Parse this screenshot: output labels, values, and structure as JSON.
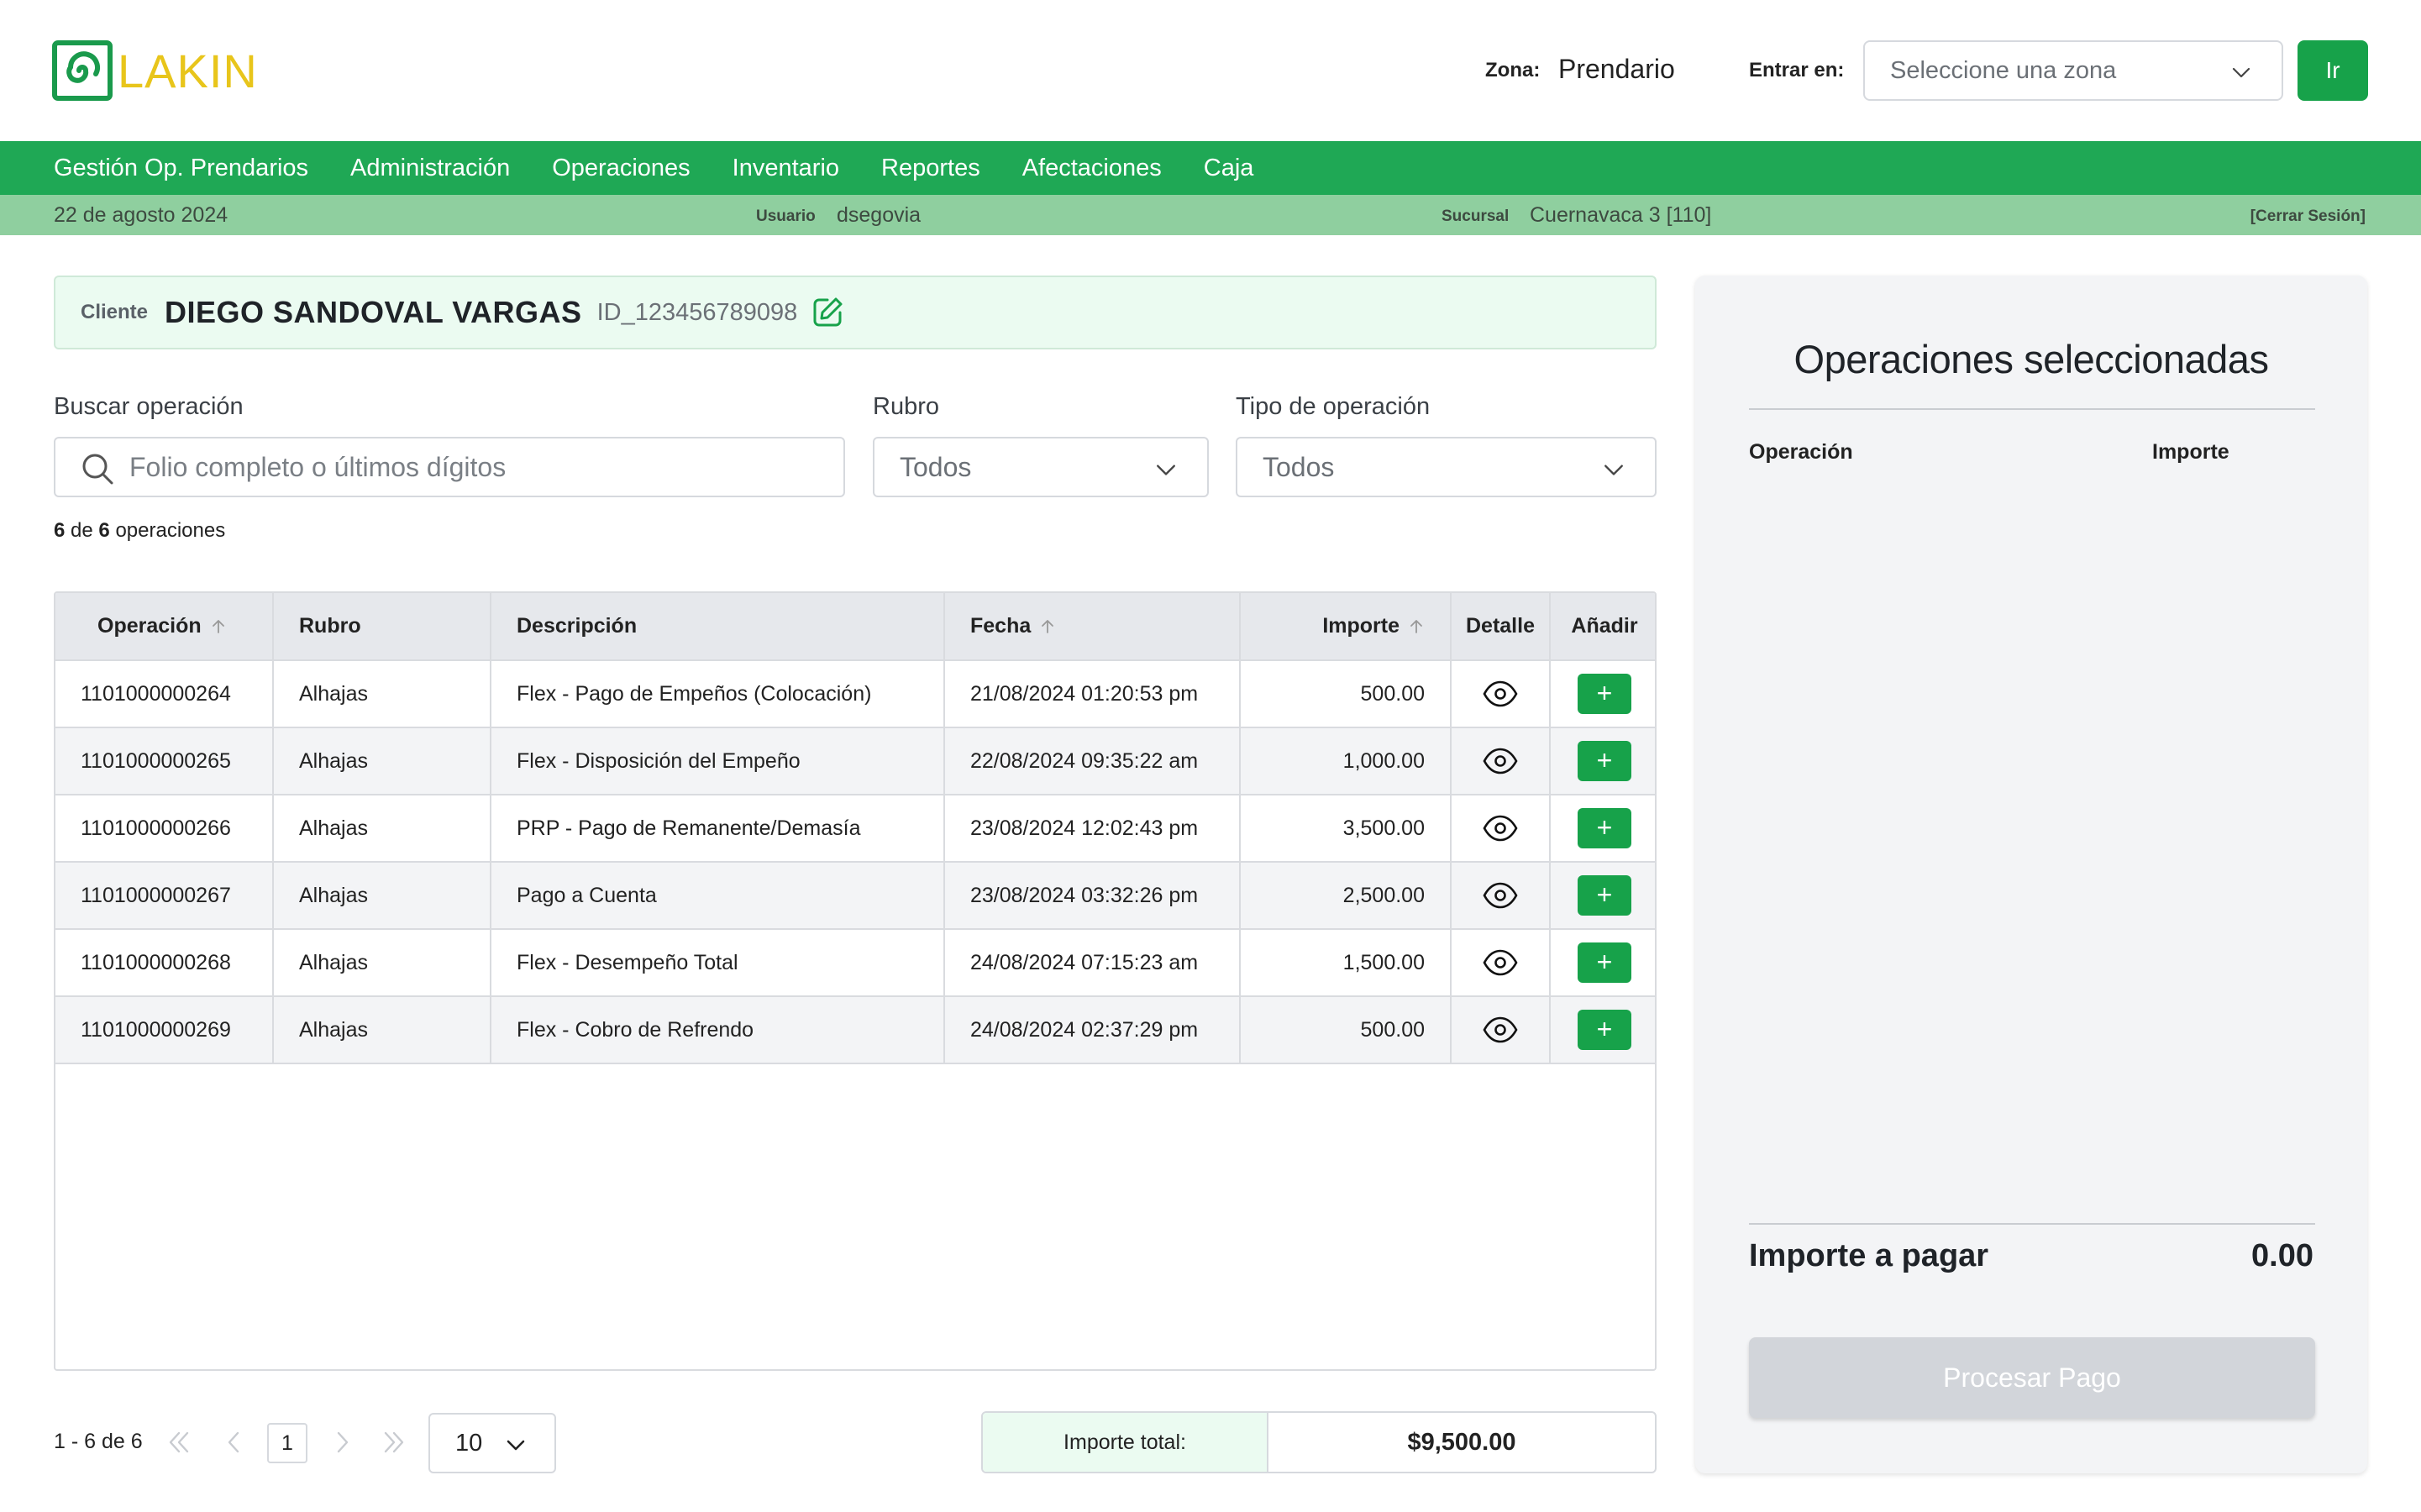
{
  "header": {
    "logo_text": "LAKIN",
    "zona_label": "Zona:",
    "zona_value": "Prendario",
    "entrar_label": "Entrar en:",
    "zona_select_placeholder": "Seleccione una zona",
    "go_label": "Ir"
  },
  "nav": {
    "items": [
      {
        "label": "Gestión Op. Prendarios"
      },
      {
        "label": "Administración"
      },
      {
        "label": "Operaciones"
      },
      {
        "label": "Inventario"
      },
      {
        "label": "Reportes"
      },
      {
        "label": "Afectaciones"
      },
      {
        "label": "Caja"
      }
    ]
  },
  "infobar": {
    "date": "22 de agosto 2024",
    "user_label": "Usuario",
    "user_value": "dsegovia",
    "branch_label": "Sucursal",
    "branch_value": "Cuernavaca 3 [110]",
    "logout": "[Cerrar Sesión]"
  },
  "client": {
    "label": "Cliente",
    "name": "DIEGO SANDOVAL VARGAS",
    "id": "ID_123456789098"
  },
  "filters": {
    "search_label": "Buscar operación",
    "search_placeholder": "Folio completo o últimos dígitos",
    "rubro_label": "Rubro",
    "rubro_value": "Todos",
    "tipo_label": "Tipo de operación",
    "tipo_value": "Todos"
  },
  "count": {
    "shown": "6",
    "of": "de",
    "total": "6",
    "suffix": "operaciones"
  },
  "table": {
    "headers": {
      "operacion": "Operación",
      "rubro": "Rubro",
      "descripcion": "Descripción",
      "fecha": "Fecha",
      "importe": "Importe",
      "detalle": "Detalle",
      "anadir": "Añadir"
    },
    "add_symbol": "+",
    "rows": [
      {
        "operacion": "1101000000264",
        "rubro": "Alhajas",
        "descripcion": "Flex - Pago de Empeños (Colocación)",
        "fecha": "21/08/2024 01:20:53 pm",
        "importe": "500.00"
      },
      {
        "operacion": "1101000000265",
        "rubro": "Alhajas",
        "descripcion": "Flex - Disposición del Empeño",
        "fecha": "22/08/2024 09:35:22 am",
        "importe": "1,000.00"
      },
      {
        "operacion": "1101000000266",
        "rubro": "Alhajas",
        "descripcion": "PRP - Pago de Remanente/Demasía",
        "fecha": "23/08/2024 12:02:43 pm",
        "importe": "3,500.00"
      },
      {
        "operacion": "1101000000267",
        "rubro": "Alhajas",
        "descripcion": "Pago a Cuenta",
        "fecha": "23/08/2024 03:32:26 pm",
        "importe": "2,500.00"
      },
      {
        "operacion": "1101000000268",
        "rubro": "Alhajas",
        "descripcion": "Flex - Desempeño Total",
        "fecha": "24/08/2024 07:15:23 am",
        "importe": "1,500.00"
      },
      {
        "operacion": "1101000000269",
        "rubro": "Alhajas",
        "descripcion": "Flex - Cobro de Refrendo",
        "fecha": "24/08/2024 02:37:29 pm",
        "importe": "500.00"
      }
    ]
  },
  "pagination": {
    "range": "1 - 6 de 6",
    "page": "1",
    "page_size": "10"
  },
  "total": {
    "label": "Importe total:",
    "value": "$9,500.00"
  },
  "panel": {
    "title": "Operaciones seleccionadas",
    "col_operacion": "Operación",
    "col_importe": "Importe",
    "pay_label": "Importe a pagar",
    "pay_value": "0.00",
    "process_label": "Procesar Pago"
  },
  "colors": {
    "brand_green": "#1fa855",
    "button_green": "#17a24a",
    "logo_yellow": "#e8c51b",
    "infobar_green": "#8fcf9f"
  }
}
